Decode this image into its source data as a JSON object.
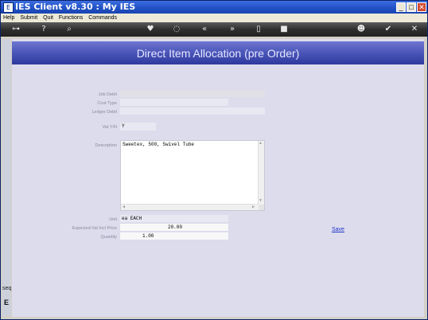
{
  "window": {
    "title": "IES Client v8.30 : My IES",
    "app_icon": "E"
  },
  "window_buttons": {
    "minimize": "_",
    "maximize": "□",
    "close": "✕"
  },
  "menu": [
    "Help",
    "Submit",
    "Quit",
    "Functions",
    "Commands"
  ],
  "toolbar_icons": [
    "key-icon",
    "help-icon",
    "search-icon",
    "heart-icon",
    "power-icon",
    "rewind-icon",
    "fast-forward-icon",
    "clipboard-icon",
    "stop-icon",
    "globe-icon",
    "check-icon",
    "close-icon"
  ],
  "toolbar_glyphs": [
    "⊶",
    "?",
    "⌕",
    "♥",
    "◌",
    "«",
    "»",
    "▯",
    "■",
    "☻",
    "✔",
    "✕"
  ],
  "side": {
    "mark_top": "seq",
    "mark_bottom": "E"
  },
  "page": {
    "title": "Direct Item Allocation (pre Order)"
  },
  "form": {
    "job_debit": {
      "label": "Job Debit",
      "value": ""
    },
    "cost_type": {
      "label": "Cost Type",
      "value": ""
    },
    "ledger_debit": {
      "label": "Ledger Debit",
      "value": ""
    },
    "vat": {
      "label": "Vat Y/N",
      "value": "Y"
    },
    "description": {
      "label": "Description",
      "value": "Sweetex, 500, Swivel Tube"
    },
    "unit": {
      "label": "Unit",
      "value": "ea EACH"
    },
    "expected_val": {
      "label": "Expected Val Incl Price",
      "value": "20.00"
    },
    "quantity": {
      "label": "Quantity",
      "value": "1.00"
    }
  },
  "actions": {
    "save": "Save"
  },
  "colors": {
    "banner": "#4a55b8",
    "content_bg": "#dcdcec",
    "link": "#2233cc"
  }
}
